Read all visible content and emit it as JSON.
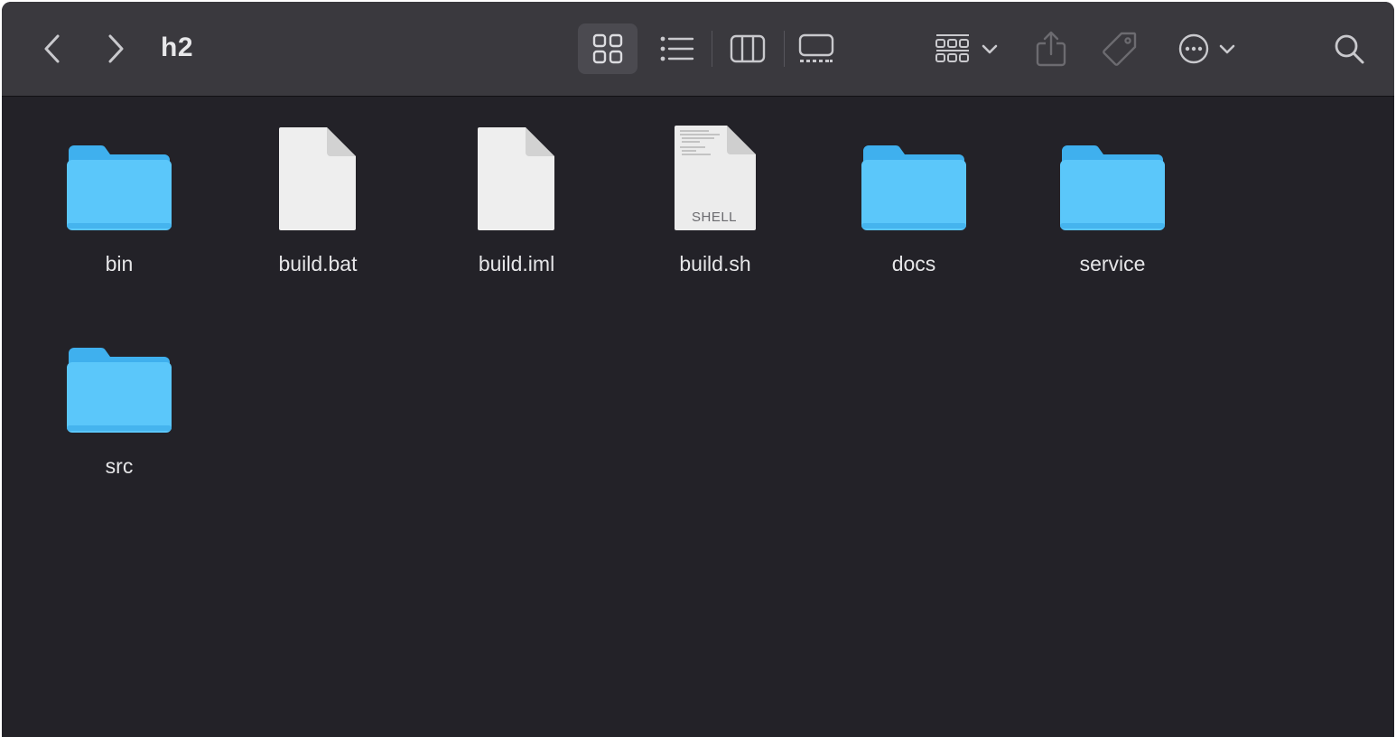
{
  "window": {
    "title": "h2"
  },
  "toolbar": {
    "back_icon": "chevron-left-icon",
    "forward_icon": "chevron-right-icon",
    "view_modes": [
      "icons",
      "list",
      "columns",
      "gallery"
    ],
    "selected_view": "icons",
    "group_icon": "group-grid-icon",
    "share_icon": "share-icon",
    "tag_icon": "tag-icon",
    "more_icon": "ellipsis-circle-icon",
    "search_icon": "search-icon"
  },
  "files": [
    {
      "name": "bin",
      "kind": "folder"
    },
    {
      "name": "build.bat",
      "kind": "document"
    },
    {
      "name": "build.iml",
      "kind": "document"
    },
    {
      "name": "build.sh",
      "kind": "shell-script",
      "badge": "SHELL"
    },
    {
      "name": "docs",
      "kind": "folder"
    },
    {
      "name": "service",
      "kind": "folder"
    },
    {
      "name": "src",
      "kind": "folder"
    }
  ],
  "colors": {
    "folder": "#5bc7fa",
    "folder_tab": "#3fb0ee",
    "toolbar_bg": "#3a393e",
    "content_bg": "#232228"
  }
}
